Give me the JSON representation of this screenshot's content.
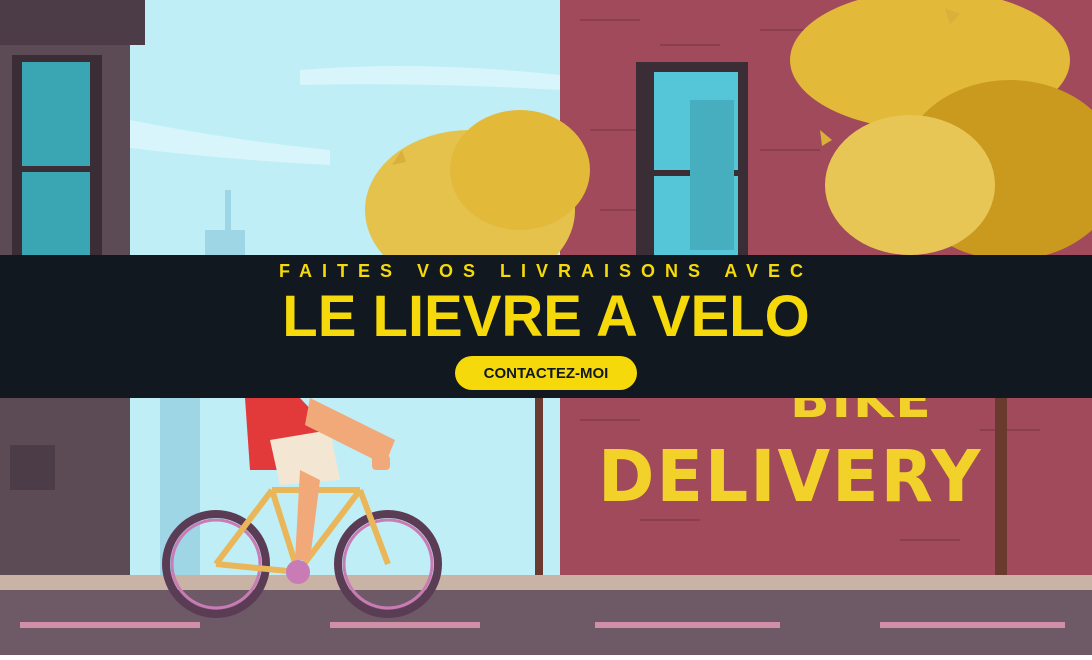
{
  "hero": {
    "eyebrow": "FAITES VOS LIVRAISONS AVEC",
    "title": "LE LIEVRE A VELO",
    "cta_label": "CONTACTEZ-MOI"
  },
  "illustration": {
    "sign_line1": "BIKE",
    "sign_line2": "DELIVERY"
  },
  "colors": {
    "accent": "#f5d90a",
    "band": "#111820",
    "sky": "#bfeef7",
    "brick": "#a04a5c"
  }
}
